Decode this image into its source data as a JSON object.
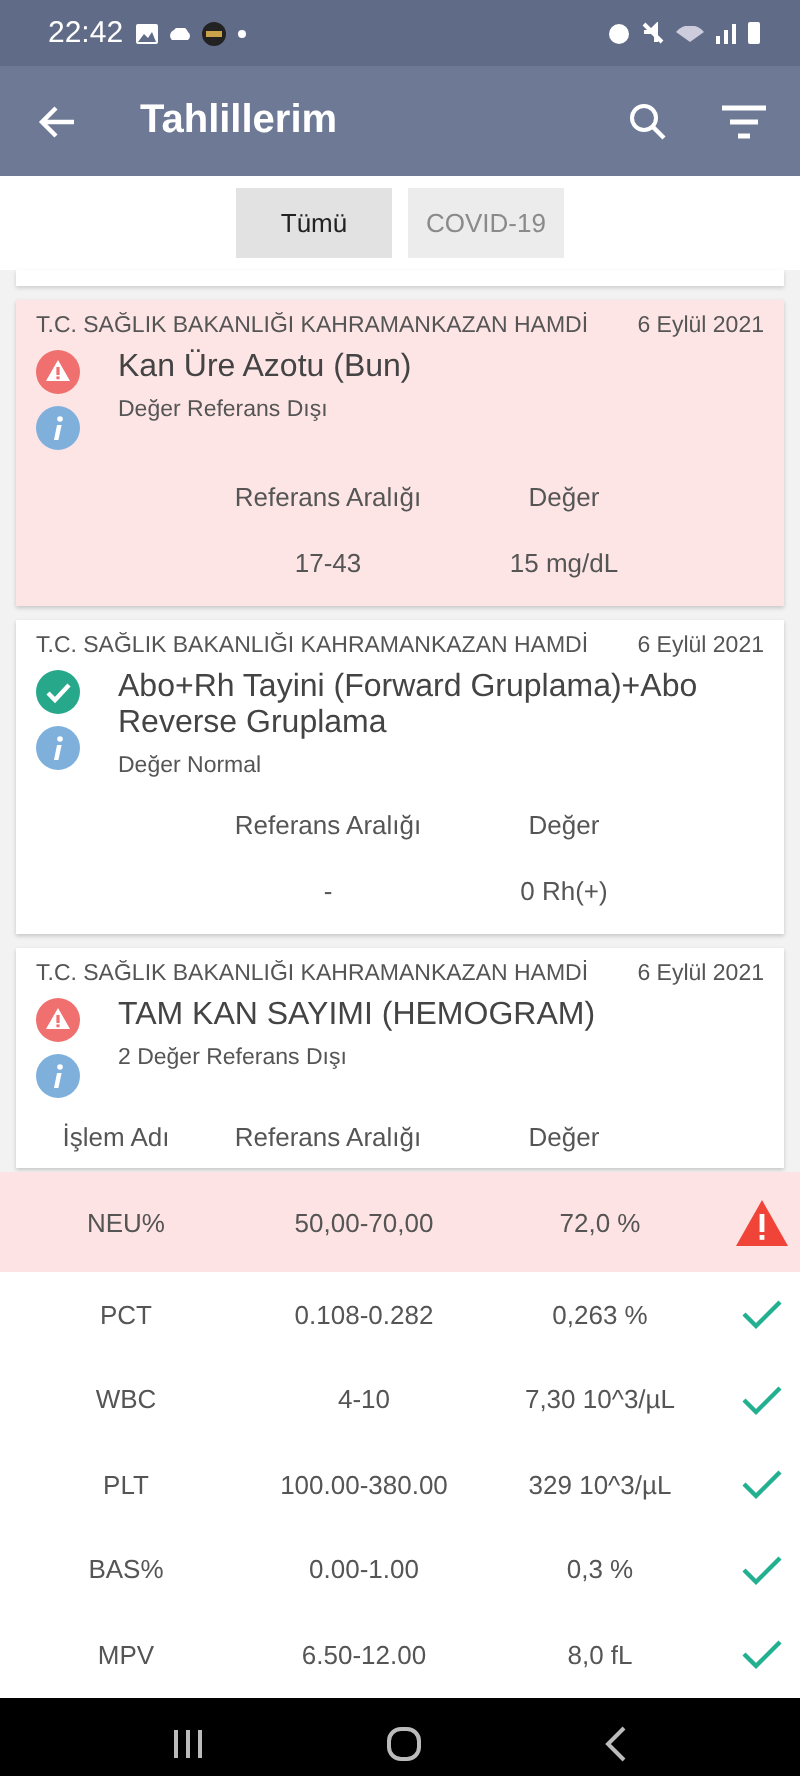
{
  "status_bar": {
    "time": "22:42"
  },
  "app_bar": {
    "title": "Tahlillerim"
  },
  "filters": [
    {
      "label": "Tümü",
      "selected": true,
      "disabled": false
    },
    {
      "label": "COVID-19",
      "selected": false,
      "disabled": true
    }
  ],
  "cards": [
    {
      "hospital": "T.C. SAĞLIK BAKANLIĞI KAHRAMANKAZAN HAMDİ",
      "date": "6 Eylül 2021",
      "kind": "abnormal",
      "highlighted": true,
      "title": "Kan Üre Azotu (Bun)",
      "summary": "Değer Referans Dışı",
      "columns": [
        "Referans Aralığı",
        "Değer"
      ],
      "values": [
        "17-43",
        "15 mg/dL"
      ]
    },
    {
      "hospital": "T.C. SAĞLIK BAKANLIĞI KAHRAMANKAZAN HAMDİ",
      "date": "6 Eylül 2021",
      "kind": "normal",
      "highlighted": false,
      "title": "Abo+Rh Tayini   (Forward Gruplama)+Abo Reverse Gruplama",
      "summary": "Değer Normal",
      "columns": [
        "Referans Aralığı",
        "Değer"
      ],
      "values": [
        "-",
        "0 Rh(+)"
      ]
    },
    {
      "hospital": "T.C. SAĞLIK BAKANLIĞI KAHRAMANKAZAN HAMDİ",
      "date": "6 Eylül 2021",
      "kind": "abnormal",
      "highlighted": false,
      "title": "TAM KAN SAYIMI (HEMOGRAM)",
      "summary": "2 Değer Referans Dışı",
      "columns": [
        "İşlem Adı",
        "Referans Aralığı",
        "Değer"
      ]
    }
  ],
  "results": [
    {
      "name": "NEU%",
      "range": "50,00-70,00",
      "value": "72,0 %",
      "kind": "abnormal"
    },
    {
      "name": "PCT",
      "range": "0.108-0.282",
      "value": "0,263 %",
      "kind": "normal"
    },
    {
      "name": "WBC",
      "range": "4-10",
      "value": "7,30 10^3/µL",
      "kind": "normal"
    },
    {
      "name": "PLT",
      "range": "100.00-380.00",
      "value": "329 10^3/µL",
      "kind": "normal"
    },
    {
      "name": "BAS%",
      "range": "0.00-1.00",
      "value": "0,3 %",
      "kind": "normal"
    },
    {
      "name": "MPV",
      "range": "6.50-12.00",
      "value": "8,0 fL",
      "kind": "normal"
    }
  ]
}
